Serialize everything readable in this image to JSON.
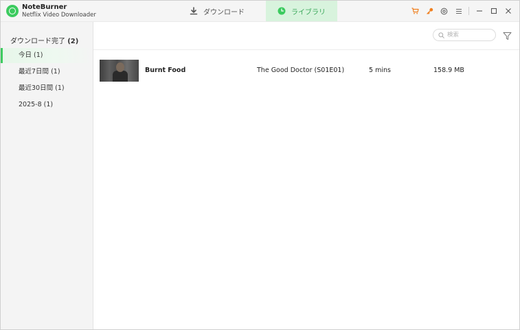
{
  "app": {
    "name": "NoteBurner",
    "subtitle": "Netflix Video Downloader"
  },
  "tabs": {
    "download": "ダウンロード",
    "library": "ライブラリ"
  },
  "sidebar": {
    "header_label": "ダウンロード完了",
    "header_count": "(2)",
    "items": [
      {
        "label": "今日 (1)",
        "active": true
      },
      {
        "label": "最近7日間 (1)",
        "active": false
      },
      {
        "label": "最近30日間 (1)",
        "active": false
      },
      {
        "label": "2025-8 (1)",
        "active": false
      }
    ]
  },
  "search": {
    "placeholder": "検索"
  },
  "library_items": [
    {
      "title": "Burnt Food",
      "series": "The Good Doctor (S01E01)",
      "duration": "5 mins",
      "size": "158.9 MB"
    }
  ],
  "icons": {
    "cart": "cart-icon",
    "key": "key-icon",
    "settings": "gear-icon",
    "menu": "menu-icon",
    "minimize": "minimize-icon",
    "maximize": "maximize-icon",
    "close": "close-icon",
    "filter": "filter-icon",
    "search": "search-icon"
  },
  "colors": {
    "accent": "#3ccb5f",
    "tab_active_bg": "#d8f3dd",
    "toolbar_icon": "#f07f1f"
  }
}
